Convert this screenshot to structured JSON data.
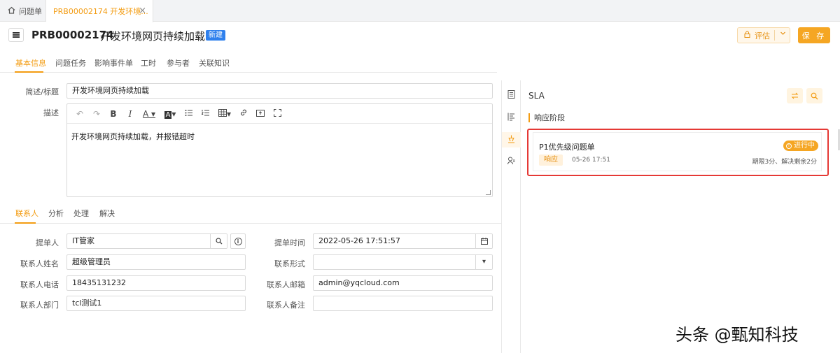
{
  "tabs": {
    "home_label": "问题单",
    "active_label": "PRB00002174 开发环境...",
    "close_glyph": "×"
  },
  "header": {
    "code": "PRB00002174",
    "title": "开发环境网页持续加载",
    "status_badge": "新建",
    "evaluate_label": "评估",
    "save_label": "保 存"
  },
  "main_tabs": [
    "基本信息",
    "问题任务",
    "影响事件单",
    "工时",
    "参与者",
    "关联知识"
  ],
  "form": {
    "summary_label": "简述/标题",
    "summary_value": "开发环境网页持续加载",
    "desc_label": "描述",
    "desc_content": "开发环境网页持续加载，并报错超时"
  },
  "sub_tabs": [
    "联系人",
    "分析",
    "处理",
    "解决"
  ],
  "contact": {
    "submitter_label": "提单人",
    "submitter_value": "IT管家",
    "submit_time_label": "提单时间",
    "submit_time_value": "2022-05-26 17:51:57",
    "name_label": "联系人姓名",
    "name_value": "超级管理员",
    "form_label": "联系形式",
    "form_value": "",
    "phone_label": "联系人电话",
    "phone_value": "18435131232",
    "email_label": "联系人邮箱",
    "email_value": "admin@yqcloud.com",
    "dept_label": "联系人部门",
    "dept_value": "tcl测试1",
    "note_label": "联系人备注",
    "note_value": ""
  },
  "sla": {
    "title": "SLA",
    "stage": "响应阶段",
    "item_name": "P1优先级问题单",
    "status": "进行中",
    "phase": "响应",
    "phase_time": "05-26 17:51",
    "deadline": "期限3分、解决剩余2分"
  },
  "watermark": "头条 @甄知科技",
  "colors": {
    "accent": "#f39c12",
    "badge_blue": "#2f80ed",
    "highlight_red": "#e53935"
  }
}
